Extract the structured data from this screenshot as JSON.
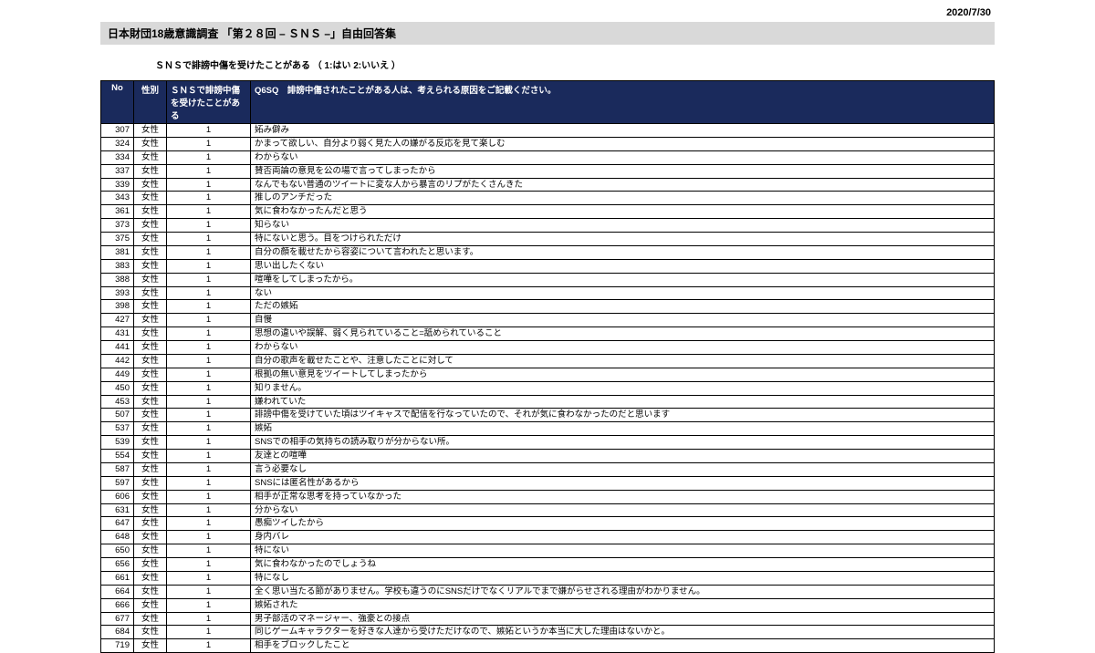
{
  "date": "2020/7/30",
  "title": "日本財団18歳意識調査 「第２８回 – ＳＮＳ –」自由回答集",
  "subtitle": "ＳＮＳで誹謗中傷を受けたことがある （ 1:はい  2:いいえ  ）",
  "headers": {
    "no": "No",
    "sex": "性別",
    "exp": "ＳＮＳで誹謗中傷を受けたことがある",
    "reason": "Q6SQ　誹謗中傷されたことがある人は、考えられる原因をご記載ください。"
  },
  "rows": [
    {
      "no": 307,
      "sex": "女性",
      "exp": 1,
      "reason": "妬み僻み"
    },
    {
      "no": 324,
      "sex": "女性",
      "exp": 1,
      "reason": "かまって欲しい、自分より弱く見た人の嫌がる反応を見て楽しむ"
    },
    {
      "no": 334,
      "sex": "女性",
      "exp": 1,
      "reason": "わからない"
    },
    {
      "no": 337,
      "sex": "女性",
      "exp": 1,
      "reason": "賛否両論の意見を公の場で言ってしまったから"
    },
    {
      "no": 339,
      "sex": "女性",
      "exp": 1,
      "reason": "なんでもない普通のツイートに変な人から暴言のリプがたくさんきた"
    },
    {
      "no": 343,
      "sex": "女性",
      "exp": 1,
      "reason": "推しのアンチだった"
    },
    {
      "no": 361,
      "sex": "女性",
      "exp": 1,
      "reason": "気に食わなかったんだと思う"
    },
    {
      "no": 373,
      "sex": "女性",
      "exp": 1,
      "reason": "知らない"
    },
    {
      "no": 375,
      "sex": "女性",
      "exp": 1,
      "reason": "特にないと思う。目をつけられただけ"
    },
    {
      "no": 381,
      "sex": "女性",
      "exp": 1,
      "reason": "自分の顔を載せたから容姿について言われたと思います。"
    },
    {
      "no": 383,
      "sex": "女性",
      "exp": 1,
      "reason": "思い出したくない"
    },
    {
      "no": 388,
      "sex": "女性",
      "exp": 1,
      "reason": "喧嘩をしてしまったから。"
    },
    {
      "no": 393,
      "sex": "女性",
      "exp": 1,
      "reason": "ない"
    },
    {
      "no": 398,
      "sex": "女性",
      "exp": 1,
      "reason": "ただの嫉妬"
    },
    {
      "no": 427,
      "sex": "女性",
      "exp": 1,
      "reason": "自慢"
    },
    {
      "no": 431,
      "sex": "女性",
      "exp": 1,
      "reason": "思想の違いや誤解、弱く見られていること=舐められていること"
    },
    {
      "no": 441,
      "sex": "女性",
      "exp": 1,
      "reason": "わからない"
    },
    {
      "no": 442,
      "sex": "女性",
      "exp": 1,
      "reason": "自分の歌声を載せたことや、注意したことに対して"
    },
    {
      "no": 449,
      "sex": "女性",
      "exp": 1,
      "reason": "根拠の無い意見をツイートしてしまったから"
    },
    {
      "no": 450,
      "sex": "女性",
      "exp": 1,
      "reason": "知りません。"
    },
    {
      "no": 453,
      "sex": "女性",
      "exp": 1,
      "reason": "嫌われていた"
    },
    {
      "no": 507,
      "sex": "女性",
      "exp": 1,
      "reason": "誹謗中傷を受けていた頃はツイキャスで配信を行なっていたので、それが気に食わなかったのだと思います"
    },
    {
      "no": 537,
      "sex": "女性",
      "exp": 1,
      "reason": "嫉妬"
    },
    {
      "no": 539,
      "sex": "女性",
      "exp": 1,
      "reason": "SNSでの相手の気持ちの読み取りが分からない所。"
    },
    {
      "no": 554,
      "sex": "女性",
      "exp": 1,
      "reason": "友達との喧嘩"
    },
    {
      "no": 587,
      "sex": "女性",
      "exp": 1,
      "reason": "言う必要なし"
    },
    {
      "no": 597,
      "sex": "女性",
      "exp": 1,
      "reason": "SNSには匿名性があるから"
    },
    {
      "no": 606,
      "sex": "女性",
      "exp": 1,
      "reason": "相手が正常な思考を持っていなかった"
    },
    {
      "no": 631,
      "sex": "女性",
      "exp": 1,
      "reason": "分からない"
    },
    {
      "no": 647,
      "sex": "女性",
      "exp": 1,
      "reason": "愚痴ツイしたから"
    },
    {
      "no": 648,
      "sex": "女性",
      "exp": 1,
      "reason": "身内バレ"
    },
    {
      "no": 650,
      "sex": "女性",
      "exp": 1,
      "reason": "特にない"
    },
    {
      "no": 656,
      "sex": "女性",
      "exp": 1,
      "reason": "気に食わなかったのでしょうね"
    },
    {
      "no": 661,
      "sex": "女性",
      "exp": 1,
      "reason": "特になし"
    },
    {
      "no": 664,
      "sex": "女性",
      "exp": 1,
      "reason": "全く思い当たる節がありません。学校も違うのにSNSだけでなくリアルでまで嫌がらせされる理由がわかりません。"
    },
    {
      "no": 666,
      "sex": "女性",
      "exp": 1,
      "reason": "嫉妬された"
    },
    {
      "no": 677,
      "sex": "女性",
      "exp": 1,
      "reason": "男子部活のマネージャー、強豪との接点"
    },
    {
      "no": 684,
      "sex": "女性",
      "exp": 1,
      "reason": "同じゲームキャラクターを好きな人達から受けただけなので、嫉妬というか本当に大した理由はないかと。"
    },
    {
      "no": 719,
      "sex": "女性",
      "exp": 1,
      "reason": "相手をブロックしたこと"
    }
  ]
}
